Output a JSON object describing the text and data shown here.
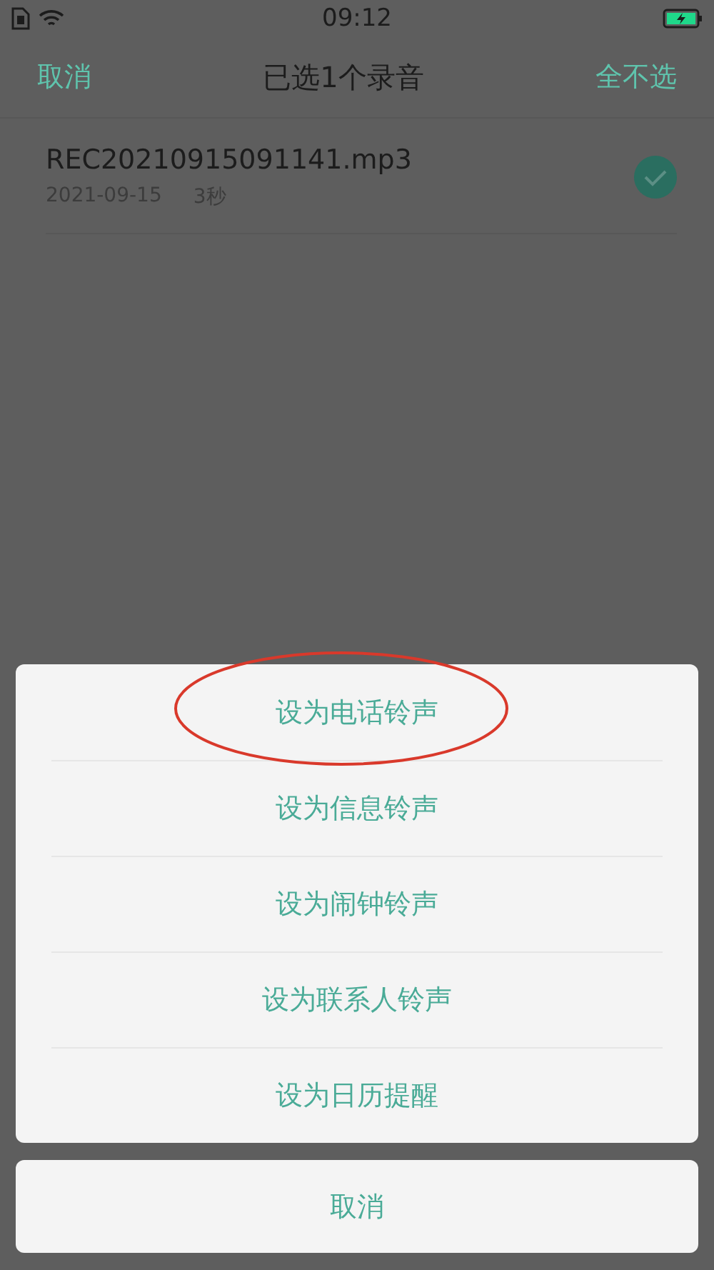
{
  "status_bar": {
    "time": "09:12",
    "charging": true
  },
  "header": {
    "left": "取消",
    "title": "已选1个录音",
    "right": "全不选"
  },
  "recordings": [
    {
      "name": "REC20210915091141.mp3",
      "date": "2021-09-15",
      "duration": "3秒",
      "selected": true
    }
  ],
  "action_sheet": {
    "options": [
      {
        "label": "设为电话铃声",
        "highlighted": true
      },
      {
        "label": "设为信息铃声",
        "highlighted": false
      },
      {
        "label": "设为闹钟铃声",
        "highlighted": false
      },
      {
        "label": "设为联系人铃声",
        "highlighted": false
      },
      {
        "label": "设为日历提醒",
        "highlighted": false
      }
    ],
    "cancel": "取消"
  }
}
